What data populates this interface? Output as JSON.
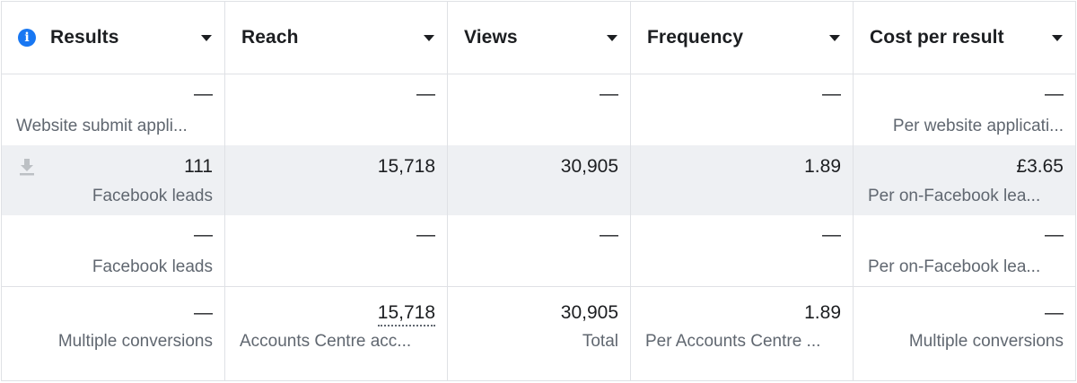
{
  "header": {
    "columns": [
      "Results",
      "Reach",
      "Views",
      "Frequency",
      "Cost per result"
    ]
  },
  "rows": [
    {
      "results": {
        "value": "—",
        "sub": "Website submit appli..."
      },
      "reach": {
        "value": "—"
      },
      "views": {
        "value": "—"
      },
      "frequency": {
        "value": "—"
      },
      "cost": {
        "value": "—",
        "sub": "Per website applicati..."
      }
    },
    {
      "results": {
        "value": "111",
        "sub": "Facebook leads"
      },
      "reach": {
        "value": "15,718"
      },
      "views": {
        "value": "30,905"
      },
      "frequency": {
        "value": "1.89"
      },
      "cost": {
        "value": "£3.65",
        "sub": "Per on-Facebook lea..."
      }
    },
    {
      "results": {
        "value": "—",
        "sub": "Facebook leads"
      },
      "reach": {
        "value": "—"
      },
      "views": {
        "value": "—"
      },
      "frequency": {
        "value": "—"
      },
      "cost": {
        "value": "—",
        "sub": "Per on-Facebook lea..."
      }
    },
    {
      "results": {
        "value": "—",
        "sub": "Multiple conversions"
      },
      "reach": {
        "value": "15,718",
        "sub": "Accounts Centre acc..."
      },
      "views": {
        "value": "30,905",
        "sub": "Total"
      },
      "frequency": {
        "value": "1.89",
        "sub": "Per Accounts Centre ..."
      },
      "cost": {
        "value": "—",
        "sub": "Multiple conversions"
      }
    }
  ],
  "colors": {
    "accent": "#1877f2",
    "row_highlight": "#eef0f3",
    "border": "#dfe1e5"
  }
}
